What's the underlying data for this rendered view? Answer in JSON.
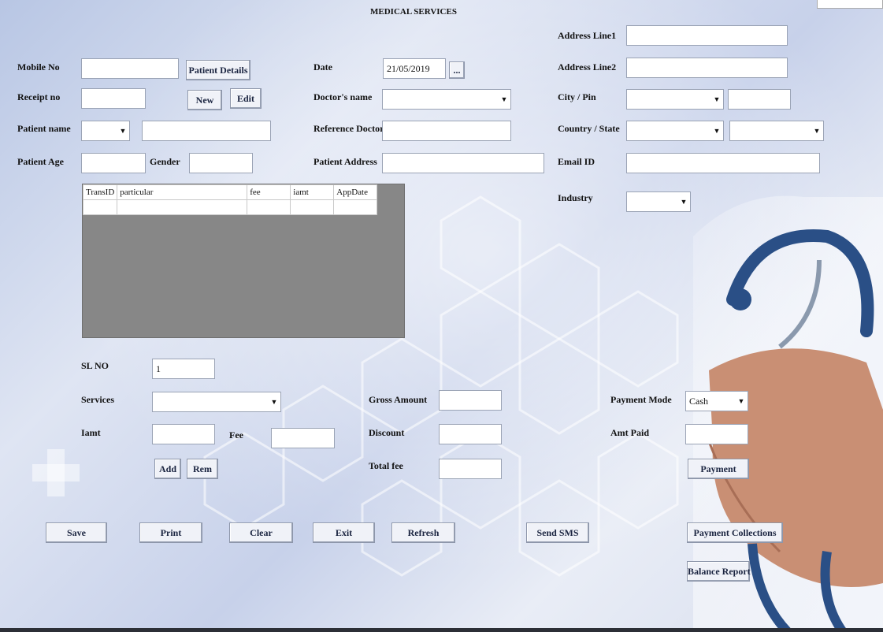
{
  "window": {
    "title": "MEDICAL SERVICES"
  },
  "patient": {
    "mobile_label": "Mobile No",
    "patient_details_button": "Patient Details",
    "receipt_label": "Receipt no",
    "new_button": "New",
    "edit_button": "Edit",
    "name_label": "Patient name",
    "age_label": "Patient Age",
    "gender_label": "Gender"
  },
  "visit": {
    "date_label": "Date",
    "date_value": "21/05/2019",
    "date_picker_button": "...",
    "doctor_label": "Doctor's name",
    "reference_label": "Reference Doctor",
    "address_label": "Patient Address"
  },
  "address": {
    "line1_label": "Address Line1",
    "line2_label": "Address Line2",
    "city_pin_label": "City / Pin",
    "country_state_label": "Country / State",
    "email_label": "Email ID",
    "industry_label": "Industry"
  },
  "grid": {
    "columns": [
      "TransID",
      "particular",
      "fee",
      "iamt",
      "AppDate"
    ],
    "rows": [
      [
        "",
        "",
        "",
        "",
        ""
      ]
    ]
  },
  "entry": {
    "slno_label": "SL NO",
    "slno_value": "1",
    "services_label": "Services",
    "iamt_label": "Iamt",
    "fee_label": "Fee",
    "add_button": "Add",
    "rem_button": "Rem"
  },
  "totals": {
    "gross_label": "Gross Amount",
    "discount_label": "Discount",
    "total_label": "Total fee"
  },
  "payment": {
    "mode_label": "Payment Mode",
    "mode_value": "Cash",
    "amt_paid_label": "Amt Paid",
    "payment_button": "Payment"
  },
  "actions": {
    "save": "Save",
    "print": "Print",
    "clear": "Clear",
    "exit": "Exit",
    "refresh": "Refresh",
    "send_sms": "Send SMS",
    "payment_collections": "Payment Collections",
    "balance_report": "Balance Report"
  }
}
